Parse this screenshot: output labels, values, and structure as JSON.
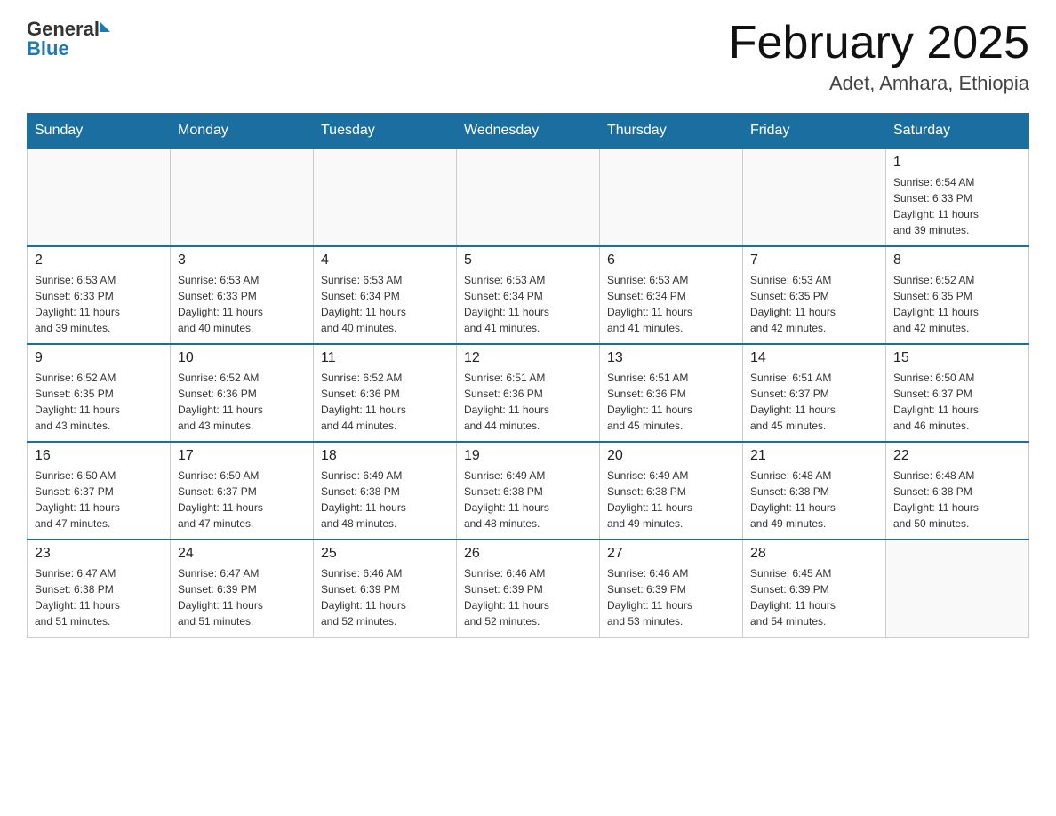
{
  "header": {
    "logo_general": "General",
    "logo_blue": "Blue",
    "title": "February 2025",
    "subtitle": "Adet, Amhara, Ethiopia"
  },
  "days_of_week": [
    "Sunday",
    "Monday",
    "Tuesday",
    "Wednesday",
    "Thursday",
    "Friday",
    "Saturday"
  ],
  "weeks": [
    {
      "days": [
        {
          "number": "",
          "info": ""
        },
        {
          "number": "",
          "info": ""
        },
        {
          "number": "",
          "info": ""
        },
        {
          "number": "",
          "info": ""
        },
        {
          "number": "",
          "info": ""
        },
        {
          "number": "",
          "info": ""
        },
        {
          "number": "1",
          "info": "Sunrise: 6:54 AM\nSunset: 6:33 PM\nDaylight: 11 hours\nand 39 minutes."
        }
      ]
    },
    {
      "days": [
        {
          "number": "2",
          "info": "Sunrise: 6:53 AM\nSunset: 6:33 PM\nDaylight: 11 hours\nand 39 minutes."
        },
        {
          "number": "3",
          "info": "Sunrise: 6:53 AM\nSunset: 6:33 PM\nDaylight: 11 hours\nand 40 minutes."
        },
        {
          "number": "4",
          "info": "Sunrise: 6:53 AM\nSunset: 6:34 PM\nDaylight: 11 hours\nand 40 minutes."
        },
        {
          "number": "5",
          "info": "Sunrise: 6:53 AM\nSunset: 6:34 PM\nDaylight: 11 hours\nand 41 minutes."
        },
        {
          "number": "6",
          "info": "Sunrise: 6:53 AM\nSunset: 6:34 PM\nDaylight: 11 hours\nand 41 minutes."
        },
        {
          "number": "7",
          "info": "Sunrise: 6:53 AM\nSunset: 6:35 PM\nDaylight: 11 hours\nand 42 minutes."
        },
        {
          "number": "8",
          "info": "Sunrise: 6:52 AM\nSunset: 6:35 PM\nDaylight: 11 hours\nand 42 minutes."
        }
      ]
    },
    {
      "days": [
        {
          "number": "9",
          "info": "Sunrise: 6:52 AM\nSunset: 6:35 PM\nDaylight: 11 hours\nand 43 minutes."
        },
        {
          "number": "10",
          "info": "Sunrise: 6:52 AM\nSunset: 6:36 PM\nDaylight: 11 hours\nand 43 minutes."
        },
        {
          "number": "11",
          "info": "Sunrise: 6:52 AM\nSunset: 6:36 PM\nDaylight: 11 hours\nand 44 minutes."
        },
        {
          "number": "12",
          "info": "Sunrise: 6:51 AM\nSunset: 6:36 PM\nDaylight: 11 hours\nand 44 minutes."
        },
        {
          "number": "13",
          "info": "Sunrise: 6:51 AM\nSunset: 6:36 PM\nDaylight: 11 hours\nand 45 minutes."
        },
        {
          "number": "14",
          "info": "Sunrise: 6:51 AM\nSunset: 6:37 PM\nDaylight: 11 hours\nand 45 minutes."
        },
        {
          "number": "15",
          "info": "Sunrise: 6:50 AM\nSunset: 6:37 PM\nDaylight: 11 hours\nand 46 minutes."
        }
      ]
    },
    {
      "days": [
        {
          "number": "16",
          "info": "Sunrise: 6:50 AM\nSunset: 6:37 PM\nDaylight: 11 hours\nand 47 minutes."
        },
        {
          "number": "17",
          "info": "Sunrise: 6:50 AM\nSunset: 6:37 PM\nDaylight: 11 hours\nand 47 minutes."
        },
        {
          "number": "18",
          "info": "Sunrise: 6:49 AM\nSunset: 6:38 PM\nDaylight: 11 hours\nand 48 minutes."
        },
        {
          "number": "19",
          "info": "Sunrise: 6:49 AM\nSunset: 6:38 PM\nDaylight: 11 hours\nand 48 minutes."
        },
        {
          "number": "20",
          "info": "Sunrise: 6:49 AM\nSunset: 6:38 PM\nDaylight: 11 hours\nand 49 minutes."
        },
        {
          "number": "21",
          "info": "Sunrise: 6:48 AM\nSunset: 6:38 PM\nDaylight: 11 hours\nand 49 minutes."
        },
        {
          "number": "22",
          "info": "Sunrise: 6:48 AM\nSunset: 6:38 PM\nDaylight: 11 hours\nand 50 minutes."
        }
      ]
    },
    {
      "days": [
        {
          "number": "23",
          "info": "Sunrise: 6:47 AM\nSunset: 6:38 PM\nDaylight: 11 hours\nand 51 minutes."
        },
        {
          "number": "24",
          "info": "Sunrise: 6:47 AM\nSunset: 6:39 PM\nDaylight: 11 hours\nand 51 minutes."
        },
        {
          "number": "25",
          "info": "Sunrise: 6:46 AM\nSunset: 6:39 PM\nDaylight: 11 hours\nand 52 minutes."
        },
        {
          "number": "26",
          "info": "Sunrise: 6:46 AM\nSunset: 6:39 PM\nDaylight: 11 hours\nand 52 minutes."
        },
        {
          "number": "27",
          "info": "Sunrise: 6:46 AM\nSunset: 6:39 PM\nDaylight: 11 hours\nand 53 minutes."
        },
        {
          "number": "28",
          "info": "Sunrise: 6:45 AM\nSunset: 6:39 PM\nDaylight: 11 hours\nand 54 minutes."
        },
        {
          "number": "",
          "info": ""
        }
      ]
    }
  ]
}
